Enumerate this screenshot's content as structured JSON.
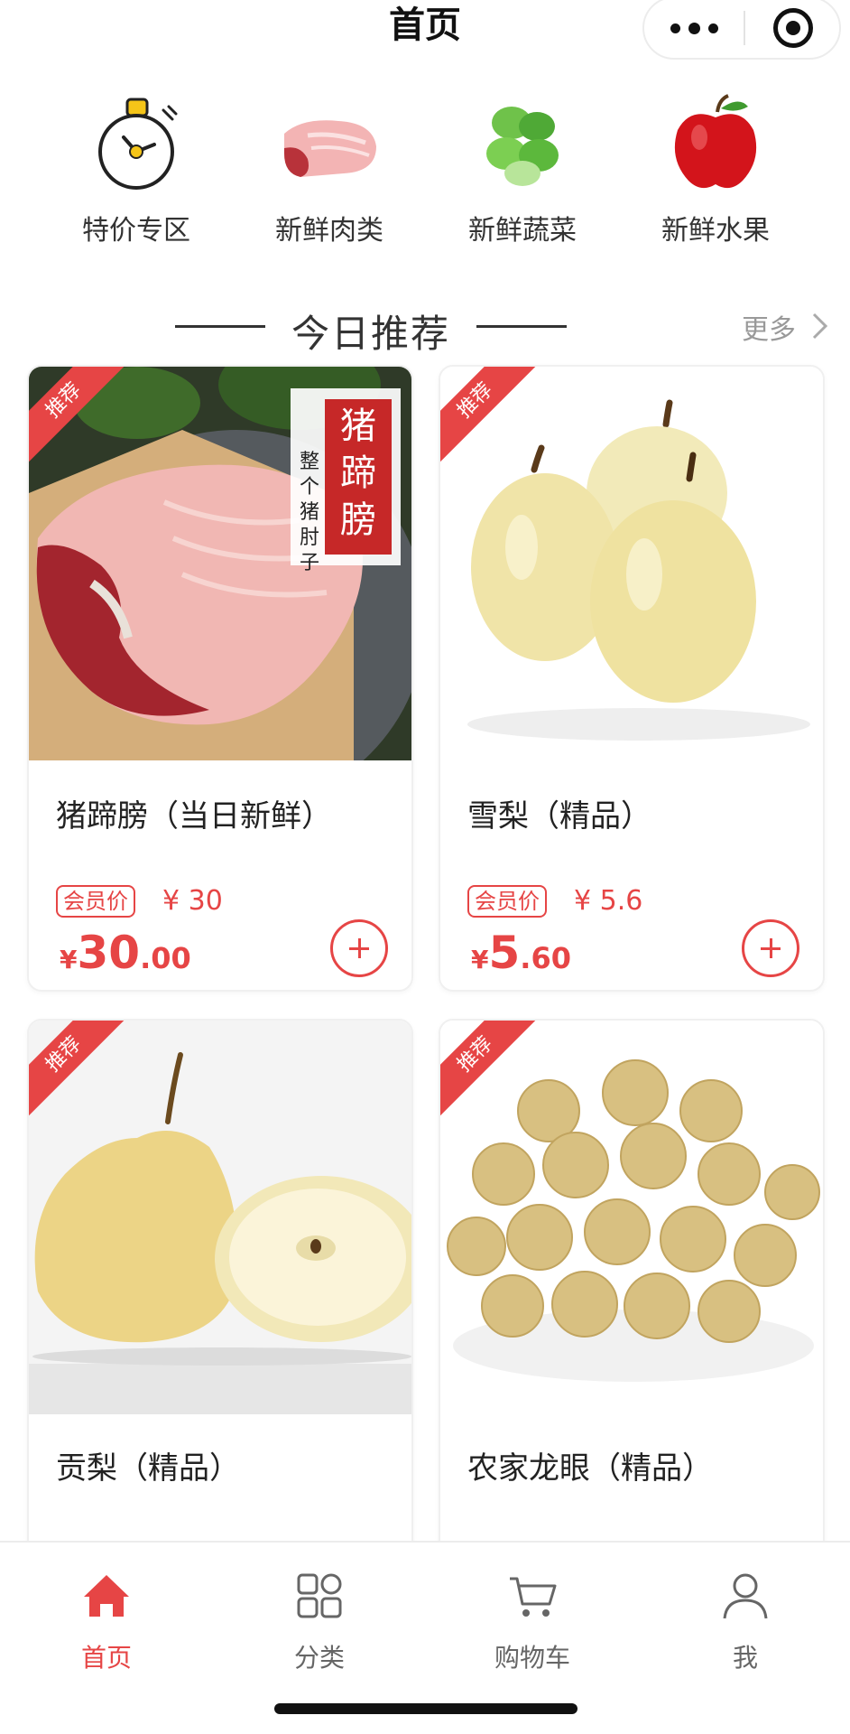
{
  "header": {
    "title": "首页"
  },
  "categories": [
    {
      "label": "特价专区",
      "icon": "clock-icon"
    },
    {
      "label": "新鲜肉类",
      "icon": "meat-icon"
    },
    {
      "label": "新鲜蔬菜",
      "icon": "vegetable-icon"
    },
    {
      "label": "新鲜水果",
      "icon": "apple-icon"
    }
  ],
  "section": {
    "title": "今日推荐",
    "more": "更多"
  },
  "products": [
    {
      "tag": "推荐",
      "name": "猪蹄膀（当日新鲜）",
      "member_label": "会员价",
      "member_price": "¥ 30",
      "price_yen": "¥",
      "price_int": "30",
      "price_dec": ".00",
      "image": "pork-knuckle-image",
      "image_caption_big": "猪蹄膀",
      "image_caption_small": "整个猪肘子"
    },
    {
      "tag": "推荐",
      "name": "雪梨（精品）",
      "member_label": "会员价",
      "member_price": "¥ 5.6",
      "price_yen": "¥",
      "price_int": "5",
      "price_dec": ".60",
      "image": "snow-pear-image"
    },
    {
      "tag": "推荐",
      "name": "贡梨（精品）",
      "image": "tribute-pear-image"
    },
    {
      "tag": "推荐",
      "name": "农家龙眼（精品）",
      "image": "longan-image"
    }
  ],
  "tabbar": [
    {
      "label": "首页",
      "icon": "home-icon",
      "active": true
    },
    {
      "label": "分类",
      "icon": "grid-icon",
      "active": false
    },
    {
      "label": "购物车",
      "icon": "cart-icon",
      "active": false
    },
    {
      "label": "我",
      "icon": "user-icon",
      "active": false
    }
  ],
  "colors": {
    "accent": "#e64545",
    "text": "#222222",
    "muted": "#999999"
  }
}
